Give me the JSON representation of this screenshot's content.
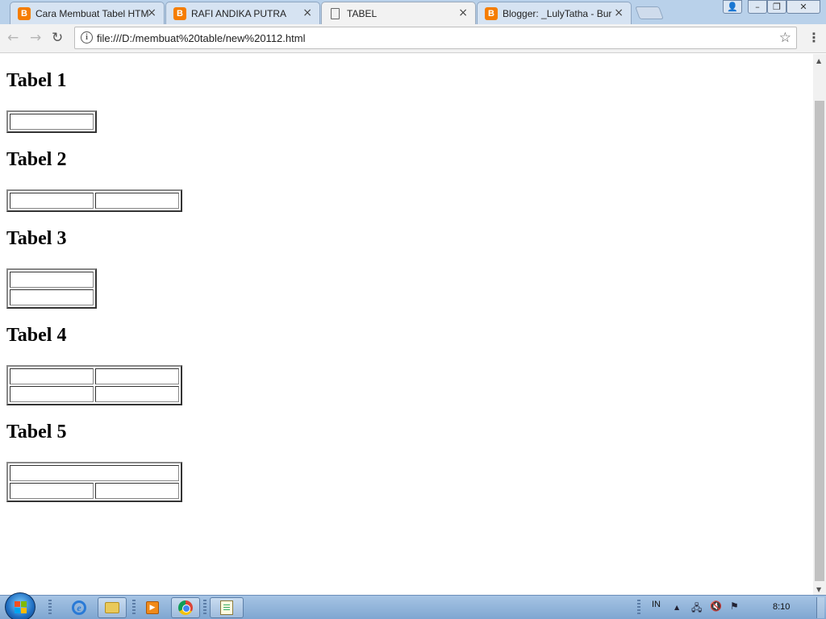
{
  "browser": {
    "tabs": [
      {
        "title": "Cara Membuat Tabel HTM",
        "icon": "blogger-icon",
        "active": false
      },
      {
        "title": "RAFI ANDIKA PUTRA",
        "icon": "blogger-icon",
        "active": false
      },
      {
        "title": "TABEL",
        "icon": "page-icon",
        "active": true
      },
      {
        "title": "Blogger: _LulyTatha - Bur",
        "icon": "blogger-icon",
        "active": false
      }
    ],
    "close_glyph": "×",
    "blogger_glyph": "B",
    "window_buttons": {
      "user": "👤",
      "minimize": "–",
      "restore": "❐",
      "close": "✕"
    },
    "nav": {
      "back": "←",
      "forward": "→",
      "reload": "↻"
    },
    "info_glyph": "i",
    "url": "file:///D:/membuat%20table/new%20112.html",
    "bookmark": "☆",
    "menu": "⋮"
  },
  "page": {
    "sections": [
      {
        "heading": "Tabel 1"
      },
      {
        "heading": "Tabel 2"
      },
      {
        "heading": "Tabel 3"
      },
      {
        "heading": "Tabel 4"
      },
      {
        "heading": "Tabel 5"
      }
    ]
  },
  "scrollbar": {
    "up": "▲",
    "down": "▼"
  },
  "taskbar": {
    "apps": [
      "internet-explorer-icon",
      "file-explorer-icon",
      "media-player-icon",
      "chrome-icon",
      "notepad-icon"
    ],
    "tray": {
      "language": "IN",
      "show_hidden": "▲",
      "network": "🖧",
      "volume": "🔇",
      "flag": "⚑",
      "time": "8:10"
    }
  }
}
